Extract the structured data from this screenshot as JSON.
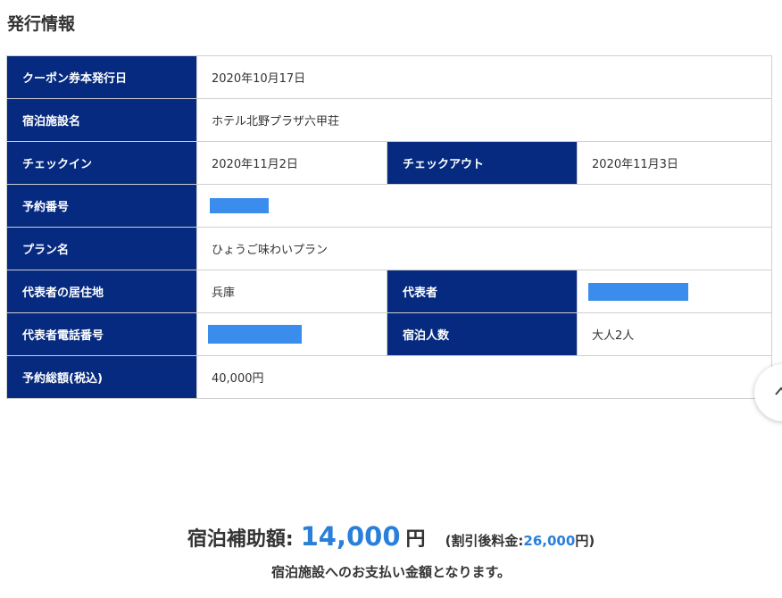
{
  "section": {
    "title": "発行情報"
  },
  "table": {
    "issue_date_label": "クーポン券本発行日",
    "issue_date_value": "2020年10月17日",
    "facility_label": "宿泊施設名",
    "facility_value": "ホテル北野プラザ六甲荘",
    "checkin_label": "チェックイン",
    "checkin_value": "2020年11月2日",
    "checkout_label": "チェックアウト",
    "checkout_value": "2020年11月3日",
    "reservation_no_label": "予約番号",
    "plan_label": "プラン名",
    "plan_value": "ひょうご味わいプラン",
    "residence_label": "代表者の居住地",
    "residence_value": "兵庫",
    "representative_label": "代表者",
    "phone_label": "代表者電話番号",
    "guests_label": "宿泊人数",
    "guests_value": "大人2人",
    "total_label": "予約総額(税込)",
    "total_value": "40,000円"
  },
  "summary": {
    "subsidy_label": "宿泊補助額:",
    "subsidy_amount": "14,000",
    "subsidy_unit": "円",
    "discount_open": "(割引後料金:",
    "discount_amount": "26,000",
    "discount_close": "円)",
    "payment_note": "宿泊施設へのお支払い金額となります。"
  },
  "colors": {
    "label_bg": "#062a80",
    "accent": "#2a7fd9",
    "redaction": "#3b8ded"
  }
}
